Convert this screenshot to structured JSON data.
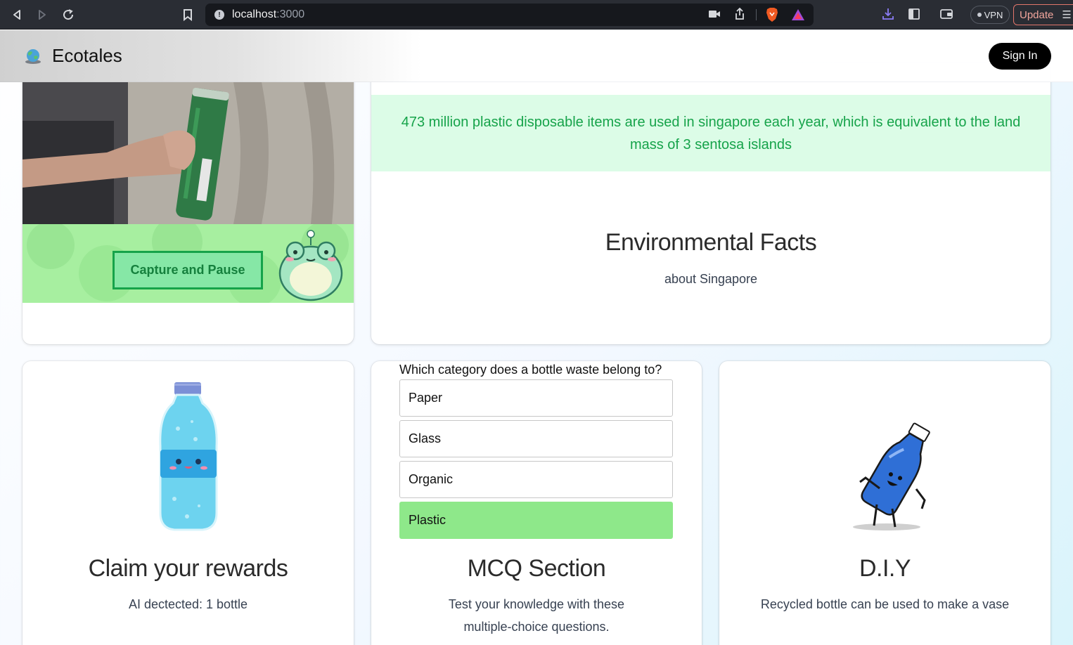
{
  "browser": {
    "url_host": "localhost",
    "url_port": ":3000",
    "vpn_label": "VPN",
    "update_label": "Update"
  },
  "header": {
    "brand": "Ecotales",
    "signin_label": "Sign In"
  },
  "camera": {
    "capture_label": "Capture and Pause"
  },
  "facts": {
    "fact_text": "473 million plastic disposable items are used in singapore each year, which is equivalent to the land mass of 3 sentosa islands",
    "title": "Environmental Facts",
    "subtitle": "about Singapore"
  },
  "rewards": {
    "title": "Claim your rewards",
    "detected_text": "AI dectected: 1 bottle"
  },
  "mcq": {
    "question": "Which category does a bottle waste belong to?",
    "options": [
      {
        "label": "Paper",
        "selected": false
      },
      {
        "label": "Glass",
        "selected": false
      },
      {
        "label": "Organic",
        "selected": false
      },
      {
        "label": "Plastic",
        "selected": true
      }
    ],
    "title": "MCQ Section",
    "description_line1": "Test your knowledge with these",
    "description_line2": "multiple-choice questions."
  },
  "diy": {
    "title": "D.I.Y",
    "description": "Recycled bottle can be used to make a vase"
  },
  "colors": {
    "fact_bg": "#dcfce7",
    "fact_text": "#16a34a",
    "camera_bar": "#a7efa0",
    "selected_option": "#8ee88a"
  }
}
